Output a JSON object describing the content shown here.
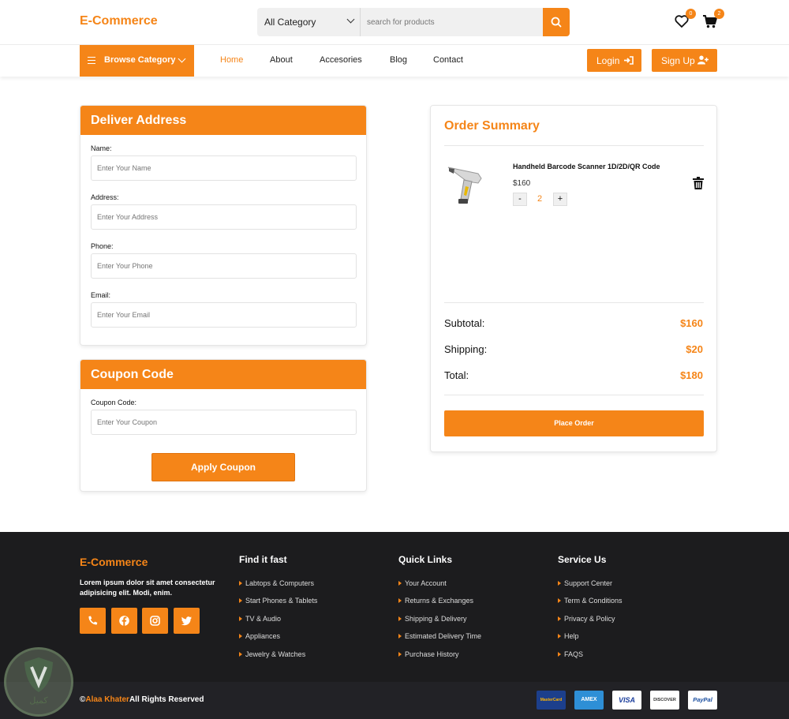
{
  "header": {
    "logo": "E-Commerce",
    "category_select": "All Category",
    "search_placeholder": "search for products",
    "wishlist_count": "0",
    "cart_count": "2"
  },
  "nav": {
    "browse": "Browse Category",
    "links": [
      "Home",
      "About",
      "Accesories",
      "Blog",
      "Contact"
    ],
    "active": "Home",
    "login": "Login",
    "signup": "Sign Up"
  },
  "deliver": {
    "title": "Deliver Address",
    "fields": [
      {
        "label": "Name:",
        "placeholder": "Enter Your Name"
      },
      {
        "label": "Address:",
        "placeholder": "Enter Your Address"
      },
      {
        "label": "Phone:",
        "placeholder": "Enter Your Phone"
      },
      {
        "label": "Email:",
        "placeholder": "Enter Your Email"
      }
    ]
  },
  "coupon": {
    "title": "Coupon Code",
    "label": "Coupon Code:",
    "placeholder": "Enter Your Coupon",
    "button": "Apply Coupon"
  },
  "summary": {
    "title": "Order Summary",
    "item": {
      "name": "Handheld Barcode Scanner 1D/2D/QR Code",
      "price": "$160",
      "qty": "2",
      "minus": "-",
      "plus": "+"
    },
    "subtotal_label": "Subtotal:",
    "subtotal": "$160",
    "shipping_label": "Shipping:",
    "shipping": "$20",
    "total_label": "Total:",
    "total": "$180",
    "button": "Place Order"
  },
  "footer": {
    "logo": "E-Commerce",
    "desc": "Lorem ipsum dolor sit amet consectetur adipisicing elit. Modi, enim.",
    "social": [
      "phone-icon",
      "facebook-icon",
      "instagram-icon",
      "twitter-icon"
    ],
    "cols": [
      {
        "title": "Find it fast",
        "links": [
          "Labtops & Computers",
          "Start Phones & Tablets",
          "TV & Audio",
          "Appliances",
          "Jewelry & Watches"
        ]
      },
      {
        "title": "Quick Links",
        "links": [
          "Your Account",
          "Returns & Exchanges",
          "Shipping & Delivery",
          "Estimated Delivery Time",
          "Purchase History"
        ]
      },
      {
        "title": "Service Us",
        "links": [
          "Support Center",
          "Term & Conditions",
          "Privacy & Policy",
          "Help",
          "FAQS"
        ]
      }
    ],
    "copyright_symbol": "©",
    "author": "Alaa Khater",
    "rights": "All Rights Reserved",
    "payments": [
      "MasterCard",
      "AMEX",
      "VISA",
      "DISCOVER",
      "PayPal"
    ]
  },
  "watermark": "كميل",
  "colors": {
    "accent": "#f58518",
    "footer_bg": "#1c1c1e"
  }
}
